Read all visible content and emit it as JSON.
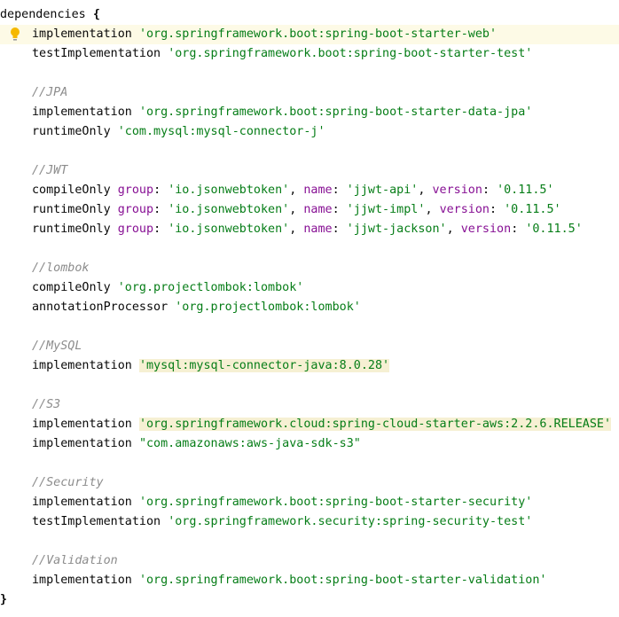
{
  "code": {
    "header": {
      "name": "dependencies",
      "open": "{"
    },
    "lines": {
      "l1": {
        "cfg": "implementation",
        "value": "'org.springframework.boot:spring-boot-starter-web'"
      },
      "l2": {
        "cfg": "testImplementation",
        "value": "'org.springframework.boot:spring-boot-starter-test'"
      },
      "c_jpa": "//JPA",
      "l3": {
        "cfg": "implementation",
        "value": "'org.springframework.boot:spring-boot-starter-data-jpa'"
      },
      "l4": {
        "cfg": "runtimeOnly",
        "value": "'com.mysql:mysql-connector-j'"
      },
      "c_jwt": "//JWT",
      "l5": {
        "cfg": "compileOnly",
        "group": "'io.jsonwebtoken'",
        "name": "'jjwt-api'",
        "version": "'0.11.5'"
      },
      "l6": {
        "cfg": "runtimeOnly",
        "group": "'io.jsonwebtoken'",
        "name": "'jjwt-impl'",
        "version": "'0.11.5'"
      },
      "l7": {
        "cfg": "runtimeOnly",
        "group": "'io.jsonwebtoken'",
        "name": "'jjwt-jackson'",
        "version": "'0.11.5'"
      },
      "c_lombok": "//lombok",
      "l8": {
        "cfg": "compileOnly",
        "value": "'org.projectlombok:lombok'"
      },
      "l9": {
        "cfg": "annotationProcessor",
        "value": "'org.projectlombok:lombok'"
      },
      "c_mysql": "//MySQL",
      "l10": {
        "cfg": "implementation",
        "value": "'mysql:mysql-connector-java:8.0.28'"
      },
      "c_s3": "//S3",
      "l11": {
        "cfg": "implementation",
        "value": "'org.springframework.cloud:spring-cloud-starter-aws:2.2.6.RELEASE'"
      },
      "l12": {
        "cfg": "implementation",
        "value": "\"com.amazonaws:aws-java-sdk-s3\""
      },
      "c_security": "//Security",
      "l13": {
        "cfg": "implementation",
        "value": "'org.springframework.boot:spring-boot-starter-security'"
      },
      "l14": {
        "cfg": "testImplementation",
        "value": "'org.springframework.security:spring-security-test'"
      },
      "c_validation": "//Validation",
      "l15": {
        "cfg": "implementation",
        "value": "'org.springframework.boot:spring-boot-starter-validation'"
      }
    },
    "footer": {
      "close": "}"
    },
    "labels": {
      "group": "group",
      "name": "name",
      "version": "version",
      "colon": ":",
      "comma": ", "
    }
  },
  "icons": {
    "intention": "lightbulb-icon"
  },
  "colors": {
    "string": "#067d17",
    "named_arg": "#871094",
    "comment": "#8c8c8c",
    "caret_line": "#fdfae6",
    "highlight": "#f6f0d3",
    "bulb": "#f5b800"
  }
}
